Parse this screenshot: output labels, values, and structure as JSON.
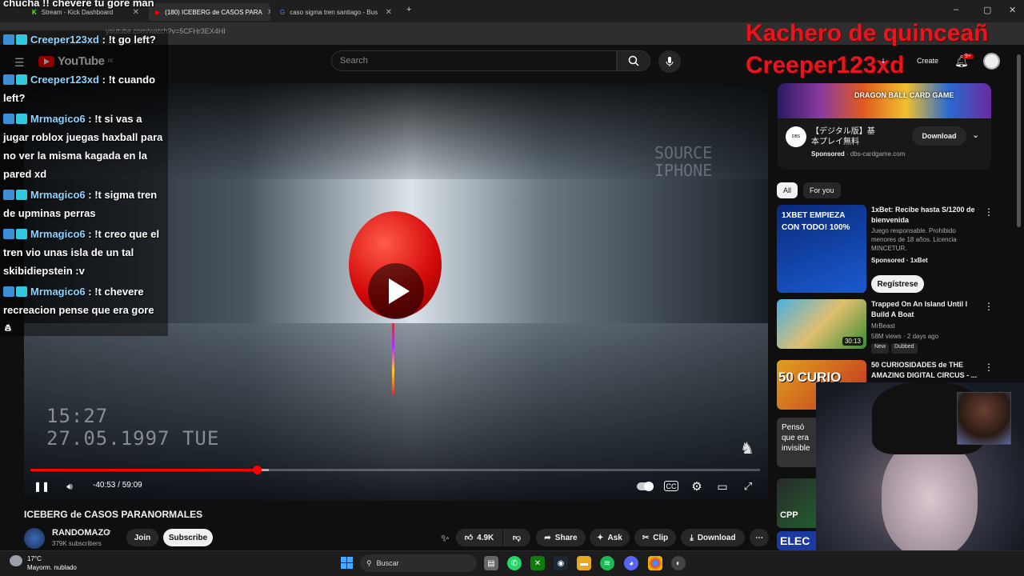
{
  "browser": {
    "tabs": [
      {
        "title": "Stream - Kick Dashboard",
        "active": false
      },
      {
        "title": "(180) ICEBERG de CASOS PARA",
        "active": true
      },
      {
        "title": "caso sigma tren santiago - Bus",
        "active": false
      }
    ],
    "url": "youtube.com/watch?v=5CFHr3EX4HI"
  },
  "youtube": {
    "logo_text": "YouTube",
    "logo_region": "PE",
    "search_placeholder": "Search",
    "create_label": "Create",
    "notifications_badge": "9+"
  },
  "video": {
    "overlay_clock": "15:27",
    "overlay_date": "27.05.1997 TUE",
    "watermark_line1": "SOURCE",
    "watermark_line2": "IPHONE",
    "time_display": "-40:53 / 59:09",
    "progress_fraction": 0.31,
    "title": "ICEBERG de CASOS PARANORMALES"
  },
  "channel": {
    "name": "RANDOMAZO",
    "subscribers": "379K subscribers",
    "join_label": "Join",
    "subscribe_label": "Subscribe"
  },
  "actions": {
    "likes": "4.9K",
    "share": "Share",
    "ask": "Ask",
    "clip": "Clip",
    "download": "Download"
  },
  "sidebar": {
    "ad": {
      "banner_text": "DRAGON BALL CARD GAME",
      "title": "【デジタル版】基本プレイ無料",
      "sponsored": "Sponsored",
      "domain": "dbs-cardgame.com",
      "button": "Download"
    },
    "chips": [
      "All",
      "For you"
    ],
    "items": [
      {
        "title": "1xBet: Recibe hasta S/1200 de bienvenida",
        "desc": "Juego responsable. Prohibido menores de 18 años. Licencia MINCETUR.",
        "meta": "Sponsored · 1xBet",
        "cta": "Regístrese",
        "thumb_text": "1XBET EMPIEZA CON TODO! 100%"
      },
      {
        "title": "Trapped On An Island Until I Build A Boat",
        "channel": "MrBeast",
        "meta": "58M views · 2 days ago",
        "duration": "30:13",
        "tags": [
          "New",
          "Dubbed"
        ]
      },
      {
        "title": "50 CURIOSIDADES de THE AMAZING DIGITAL CIRCUS - ...",
        "thumb_text": "50 CURIO"
      },
      {
        "thumb_text": "Pensó que era invisible"
      },
      {
        "thumb_text": "CPP"
      },
      {
        "thumb_text": "ELEC"
      }
    ]
  },
  "overlay": {
    "top_chat_text": "chucha !! chevere tu gore man",
    "chat": [
      {
        "user": "Creeper123xd",
        "text": ": !t go left?"
      },
      {
        "user": "Creeper123xd",
        "text": ": !t cuando left?"
      },
      {
        "user": "Mrmagico6",
        "text": ": !t si vas a jugar roblox juegas haxball para no ver la misma kagada en la pared xd"
      },
      {
        "user": "Mrmagico6",
        "text": ": !t sigma tren de upminas perras"
      },
      {
        "user": "Mrmagico6",
        "text": ": !t creo que el tren vio unas isla de un tal skibidiepstein :v"
      },
      {
        "user": "Mrmagico6",
        "text": ": !t chevere recreacion pense que era gore"
      }
    ],
    "red_line1": "Kachero de quinceañ",
    "red_line2": "Creeper123xd"
  },
  "taskbar": {
    "temperature": "17°C",
    "weather": "Mayorm. nublado",
    "search": "Buscar"
  },
  "colors": {
    "accent": "#ff0000",
    "overlay_red": "#e8141e",
    "background": "#0f0f0f"
  }
}
